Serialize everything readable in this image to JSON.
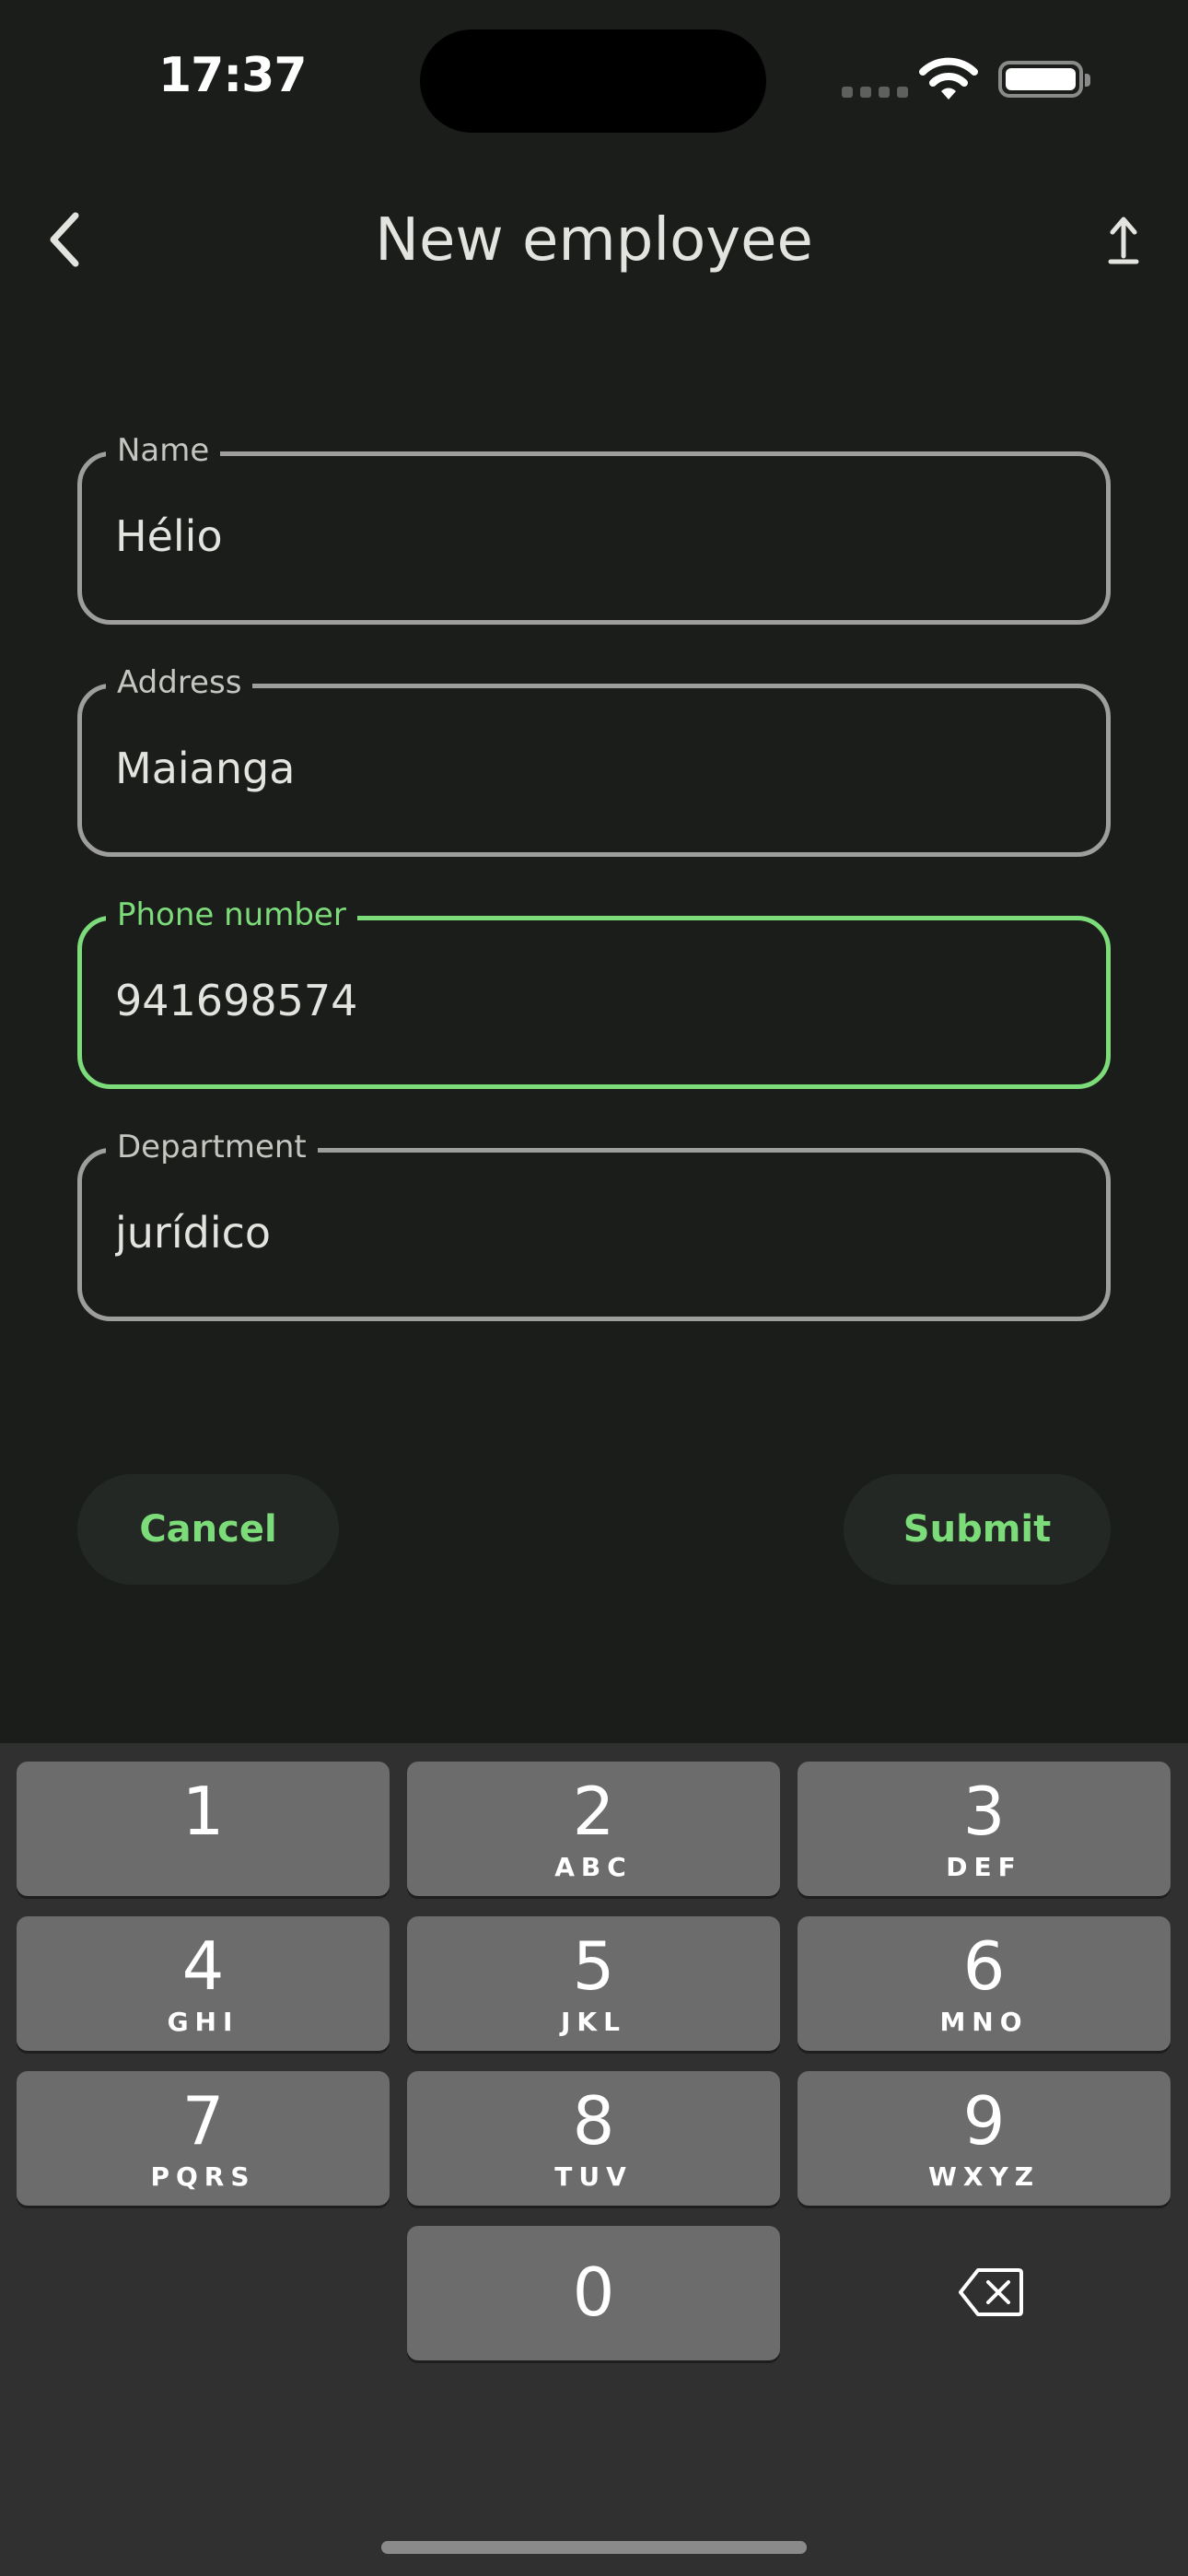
{
  "status_bar": {
    "time": "17:37"
  },
  "app_bar": {
    "title": "New employee",
    "back_icon": "chevron-left-icon",
    "action_icon": "upload-icon"
  },
  "form": {
    "fields": [
      {
        "label": "Name",
        "value": "Hélio",
        "focused": false
      },
      {
        "label": "Address",
        "value": "Maianga",
        "focused": false
      },
      {
        "label": "Phone number",
        "value": "941698574",
        "focused": true
      },
      {
        "label": "Department",
        "value": "jurídico",
        "focused": false
      }
    ],
    "cancel_label": "Cancel",
    "submit_label": "Submit"
  },
  "keyboard": {
    "keys": [
      {
        "digit": "1",
        "letters": ""
      },
      {
        "digit": "2",
        "letters": "ABC"
      },
      {
        "digit": "3",
        "letters": "DEF"
      },
      {
        "digit": "4",
        "letters": "GHI"
      },
      {
        "digit": "5",
        "letters": "JKL"
      },
      {
        "digit": "6",
        "letters": "MNO"
      },
      {
        "digit": "7",
        "letters": "PQRS"
      },
      {
        "digit": "8",
        "letters": "TUV"
      },
      {
        "digit": "9",
        "letters": "WXYZ"
      },
      {
        "digit": "0",
        "letters": ""
      }
    ],
    "delete_icon": "backspace-icon"
  },
  "colors": {
    "background": "#1b1d1b",
    "accent": "#7ddc7a",
    "field_border": "#9e9f9c",
    "keyboard_bg": "#303030",
    "key_bg": "#6c6c6c"
  }
}
